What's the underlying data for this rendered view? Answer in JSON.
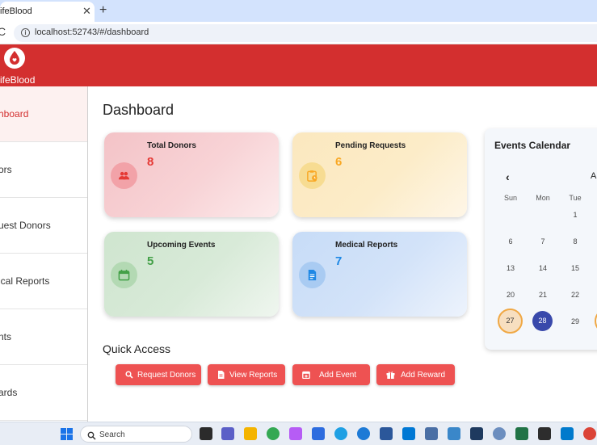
{
  "browser": {
    "tab_title": "ifeBlood",
    "tab_close": "✕",
    "new_tab": "+",
    "reload": "C",
    "info": "i",
    "url": "localhost:52743/#/dashboard"
  },
  "app": {
    "brand": "ifeBlood"
  },
  "sidebar": {
    "items": [
      {
        "label": "hboard"
      },
      {
        "label": "ors"
      },
      {
        "label": "uest Donors"
      },
      {
        "label": "ical Reports"
      },
      {
        "label": "nts"
      },
      {
        "label": "ards"
      }
    ]
  },
  "main": {
    "title": "Dashboard",
    "cards": [
      {
        "label": "Total Donors",
        "value": "8"
      },
      {
        "label": "Pending Requests",
        "value": "6"
      },
      {
        "label": "Upcoming Events",
        "value": "5"
      },
      {
        "label": "Medical Reports",
        "value": "7"
      }
    ],
    "quick_access": {
      "title": "Quick Access",
      "buttons": [
        {
          "label": "Request Donors"
        },
        {
          "label": "View Reports"
        },
        {
          "label": "Add Event"
        },
        {
          "label": "Add Reward"
        }
      ]
    }
  },
  "calendar": {
    "title": "Events Calendar",
    "prev": "‹",
    "month": "Ap",
    "weekdays": [
      "Sun",
      "Mon",
      "Tue"
    ],
    "rows": [
      [
        "",
        "",
        "1"
      ],
      [
        "6",
        "7",
        "8"
      ],
      [
        "13",
        "14",
        "15"
      ],
      [
        "20",
        "21",
        "22"
      ],
      [
        "27",
        "28",
        "29"
      ]
    ]
  },
  "taskbar": {
    "search_placeholder": "Search"
  },
  "colors": {
    "brand_red": "#d32f2f",
    "button_red": "#ee5252",
    "today": "#3949ab",
    "selected_ring": "#f0a844"
  }
}
